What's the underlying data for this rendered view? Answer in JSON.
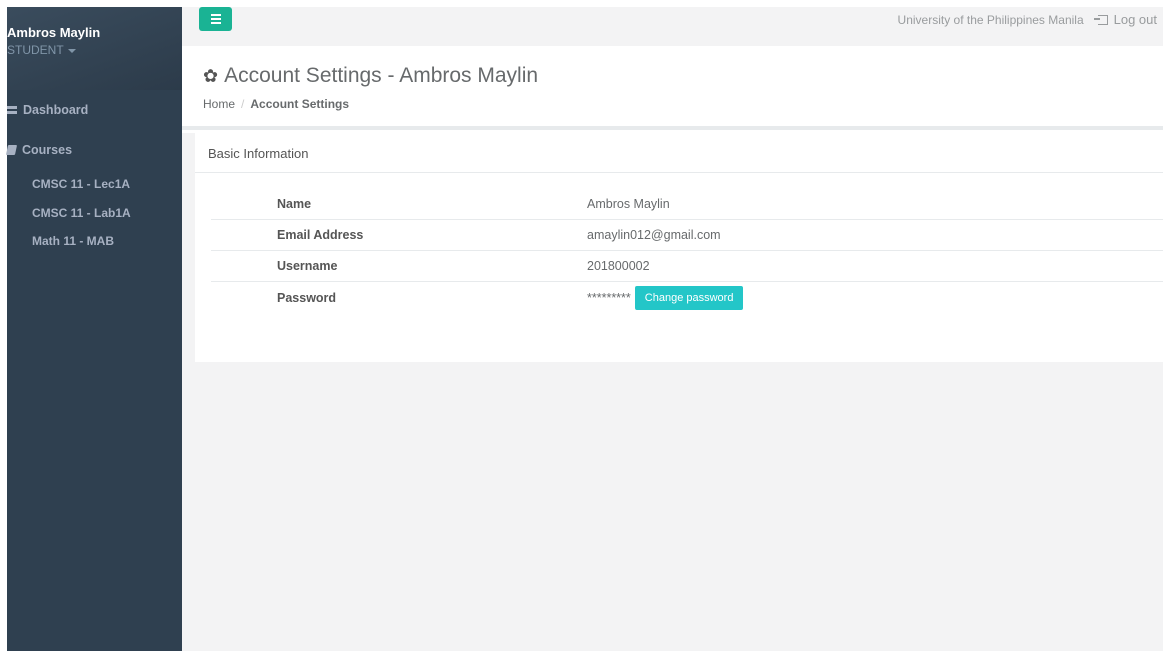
{
  "sidebar": {
    "user_name": "Ambros Maylin",
    "user_role": "STUDENT",
    "nav": {
      "dashboard": "Dashboard",
      "courses": "Courses"
    },
    "courses": [
      "CMSC 11 - Lec1A",
      "CMSC 11 - Lab1A",
      "Math 11 - MAB"
    ]
  },
  "topbar": {
    "university": "University of the Philippines Manila",
    "logout": "Log out"
  },
  "header": {
    "title": "Account Settings - Ambros Maylin",
    "breadcrumb": [
      "Home",
      "Account Settings"
    ]
  },
  "panel": {
    "title": "Basic Information",
    "rows": [
      {
        "label": "Name",
        "value": "Ambros Maylin"
      },
      {
        "label": "Email Address",
        "value": "amaylin012@gmail.com"
      },
      {
        "label": "Username",
        "value": "201800002"
      },
      {
        "label": "Password",
        "value": "*********"
      }
    ],
    "change_password_label": "Change password"
  },
  "colors": {
    "sidebar_bg": "#2f4050",
    "accent_green": "#1ab394",
    "accent_cyan": "#23c6c8",
    "content_bg": "#f3f3f4"
  },
  "icons": {
    "menu": "hamburger-icon",
    "logout": "sign-out-icon",
    "title": "gear-icon",
    "dashboard": "dashboard-icon",
    "courses": "book-icon"
  }
}
